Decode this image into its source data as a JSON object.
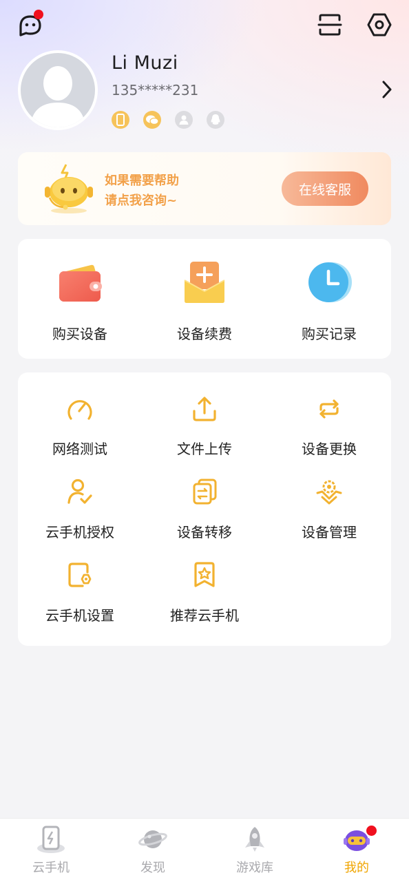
{
  "header": {
    "message_icon": "chat-bubble-icon",
    "scan_icon": "scan-icon",
    "settings_icon": "settings-hexagon-icon"
  },
  "profile": {
    "name": "Li Muzi",
    "phone": "135*****231",
    "bindings": [
      {
        "icon": "phone-icon",
        "active": true
      },
      {
        "icon": "wechat-icon",
        "active": true
      },
      {
        "icon": "user-icon",
        "active": false
      },
      {
        "icon": "qq-icon",
        "active": false
      }
    ]
  },
  "help": {
    "line1": "如果需要帮助",
    "line2": "请点我咨询~",
    "button": "在线客服"
  },
  "quick_actions": [
    {
      "label": "购买设备",
      "icon": "wallet-icon"
    },
    {
      "label": "设备续费",
      "icon": "renew-envelope-icon"
    },
    {
      "label": "购买记录",
      "icon": "clock-icon"
    }
  ],
  "tools": [
    {
      "label": "网络测试",
      "icon": "speedometer-icon"
    },
    {
      "label": "文件上传",
      "icon": "upload-icon"
    },
    {
      "label": "设备更换",
      "icon": "swap-icon"
    },
    {
      "label": "云手机授权",
      "icon": "user-check-icon"
    },
    {
      "label": "设备转移",
      "icon": "transfer-icon"
    },
    {
      "label": "设备管理",
      "icon": "device-manage-icon"
    },
    {
      "label": "云手机设置",
      "icon": "phone-settings-icon"
    },
    {
      "label": "推荐云手机",
      "icon": "bookmark-star-icon"
    }
  ],
  "tabs": [
    {
      "label": "云手机",
      "icon": "cloud-phone-icon",
      "active": false
    },
    {
      "label": "发现",
      "icon": "planet-icon",
      "active": false
    },
    {
      "label": "游戏库",
      "icon": "rocket-icon",
      "active": false
    },
    {
      "label": "我的",
      "icon": "robot-icon",
      "active": true
    }
  ],
  "colors": {
    "accent": "#f2b230",
    "active_tab": "#f0a500",
    "badge": "#f0101e"
  }
}
